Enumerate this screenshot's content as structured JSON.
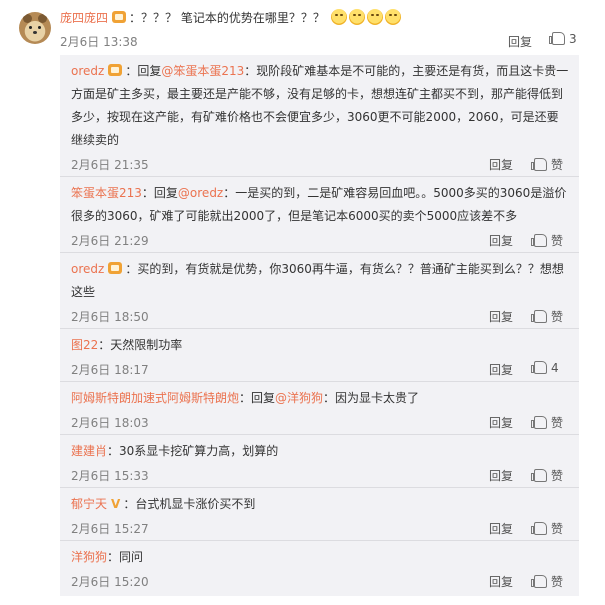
{
  "main_comment": {
    "user": "庞四庞四",
    "text": "：？？？ 笔记本的优势在哪里？？？",
    "time": "2月6日 13:38",
    "reply_label": "回复",
    "like_count": "3"
  },
  "replies": [
    {
      "user": "oredz",
      "lines": [
        "：回复",
        "@笨蛋本蛋213",
        "：现阶段矿难基本是不可能的，主要还是有货，而且这卡贵一方",
        "面是矿主多买，最主要还是产能不够，没有足够的卡，想想连矿主都买不到，那产能得低到多",
        "少，按现在这产能，有矿难价格也不会便宜多少，3060更不可能2000，2060，可是还要继续",
        "卖的"
      ],
      "time": "2月6日 21:35",
      "reply_label": "回复",
      "like_label": "赞"
    },
    {
      "user": "笨蛋本蛋213",
      "lines": [
        "：回复",
        "@oredz",
        "：一是买的到，二是矿难容易回血吧。。5000多买的3060是溢价很",
        "多的3060，矿难了可能就出2000了，但是笔记本6000买的卖个5000应该差不多"
      ],
      "time": "2月6日 21:29",
      "reply_label": "回复",
      "like_label": "赞"
    },
    {
      "user": "oredz",
      "lines": [
        "：买的到，有货就是优势，你3060再牛逼，有货么？？普通矿主能买到么？？想想这",
        "些"
      ],
      "time": "2月6日 18:50",
      "reply_label": "回复",
      "like_label": "赞"
    },
    {
      "user": "图22",
      "lines": [
        "：天然限制功率"
      ],
      "time": "2月6日 18:17",
      "reply_label": "回复",
      "like_count": "4"
    },
    {
      "user": "阿姆斯特朗加速式阿姆斯特朗炮",
      "lines": [
        "：回复",
        "@洋狗狗",
        "：因为显卡太贵了"
      ],
      "time": "2月6日 18:03",
      "reply_label": "回复",
      "like_label": "赞"
    },
    {
      "user": "建建肖",
      "lines": [
        "：30系显卡挖矿算力高，划算的"
      ],
      "time": "2月6日 15:33",
      "reply_label": "回复",
      "like_label": "赞"
    },
    {
      "user": "郁宁天",
      "badge": "V",
      "lines": [
        "：台式机显卡涨价买不到"
      ],
      "time": "2月6日 15:27",
      "reply_label": "回复",
      "like_label": "赞"
    },
    {
      "user": "洋狗狗",
      "lines": [
        "：同问"
      ],
      "time": "2月6日 15:20",
      "reply_label": "回复",
      "like_label": "赞"
    }
  ],
  "icons": {
    "like": "thumbs-up-icon",
    "vip": "vip-badge-icon",
    "emoji": "laughing-emoji-icon",
    "avatar": "bear-avatar"
  },
  "colors": {
    "username": "#eb7350",
    "meta": "#808080",
    "reply_bg": "#f2f2f5"
  }
}
